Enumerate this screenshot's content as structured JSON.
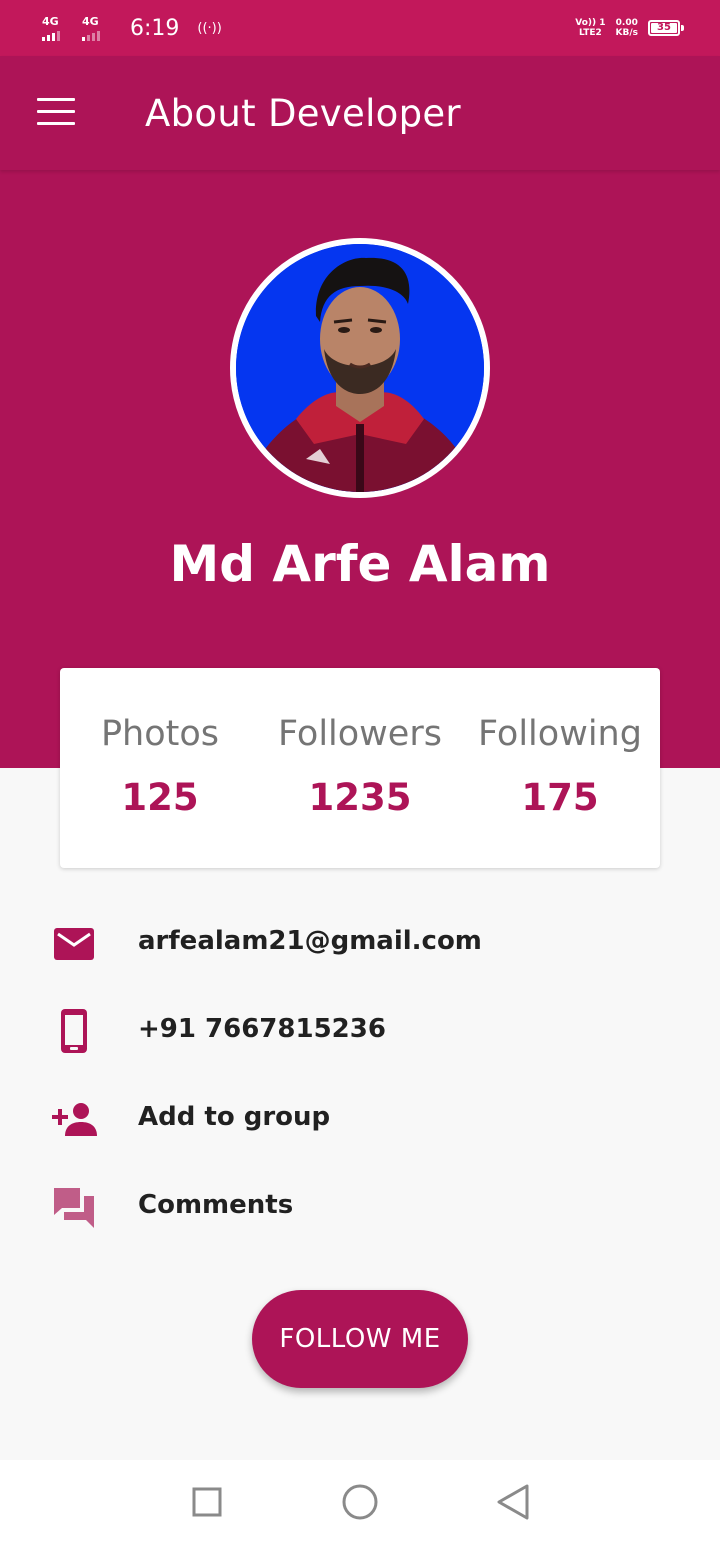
{
  "status_bar": {
    "network_1": "4G",
    "network_2": "4G",
    "time": "6:19",
    "hotspot": "((·))",
    "volte": "Vo)) 1",
    "lte": "LTE2",
    "speed_value": "0.00",
    "speed_unit": "KB/s",
    "battery": "35"
  },
  "app_bar": {
    "title": "About Developer",
    "menu_icon": "hamburger-menu-icon"
  },
  "profile": {
    "name": "Md Arfe Alam",
    "avatar": "profile-photo"
  },
  "stats": [
    {
      "label": "Photos",
      "value": "125"
    },
    {
      "label": "Followers",
      "value": "1235"
    },
    {
      "label": "Following",
      "value": "175"
    }
  ],
  "info": [
    {
      "icon": "email-icon",
      "text": "arfealam21@gmail.com"
    },
    {
      "icon": "phone-icon",
      "text": "+91 7667815236"
    },
    {
      "icon": "add-person-icon",
      "text": "Add to group"
    },
    {
      "icon": "comments-icon",
      "text": "Comments"
    }
  ],
  "follow_button": {
    "label": "FOLLOW ME"
  },
  "nav": [
    "recents-icon",
    "home-icon",
    "back-icon"
  ],
  "colors": {
    "status_bar": "#c2185b",
    "primary": "#ad1457",
    "background": "#f8f8f8",
    "stat_label": "#757575",
    "text": "#212121"
  }
}
